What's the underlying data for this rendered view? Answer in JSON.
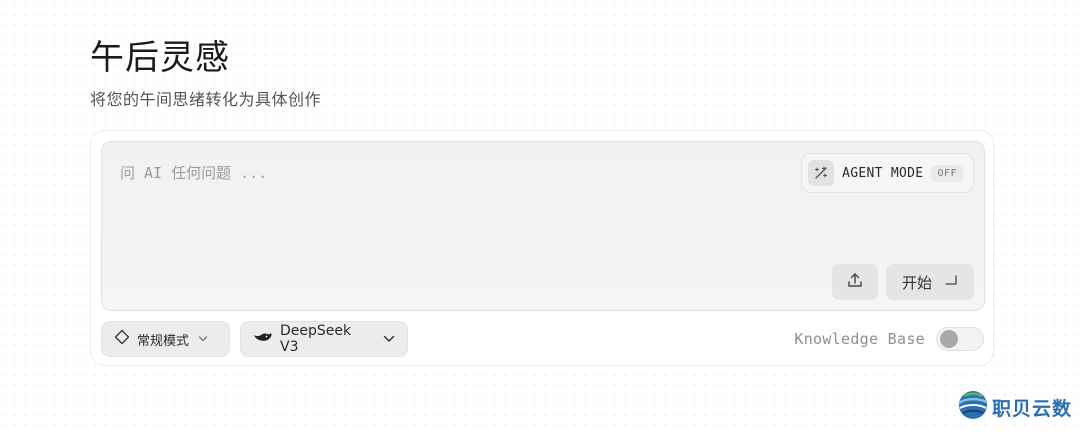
{
  "header": {
    "title": "午后灵感",
    "subtitle": "将您的午间思绪转化为具体创作"
  },
  "composer": {
    "placeholder": "问 AI 任何问题 ...",
    "agent_mode": {
      "label": "AGENT MODE",
      "state": "OFF",
      "icon": "magic-wand-icon"
    },
    "upload_icon": "upload-icon",
    "start_button": {
      "label": "开始",
      "icon": "enter-icon"
    }
  },
  "toolbar": {
    "mode_selector": {
      "value": "常规模式",
      "icon": "diamond-icon"
    },
    "model_selector": {
      "value": "DeepSeek V3",
      "icon": "deepseek-whale-icon"
    },
    "knowledge_base": {
      "label": "Knowledge Base",
      "enabled": false
    }
  },
  "watermark": {
    "text": "职贝云数"
  },
  "colors": {
    "accent_watermark": "#2c6fb0",
    "toggle_off": "#a9a9a9"
  }
}
